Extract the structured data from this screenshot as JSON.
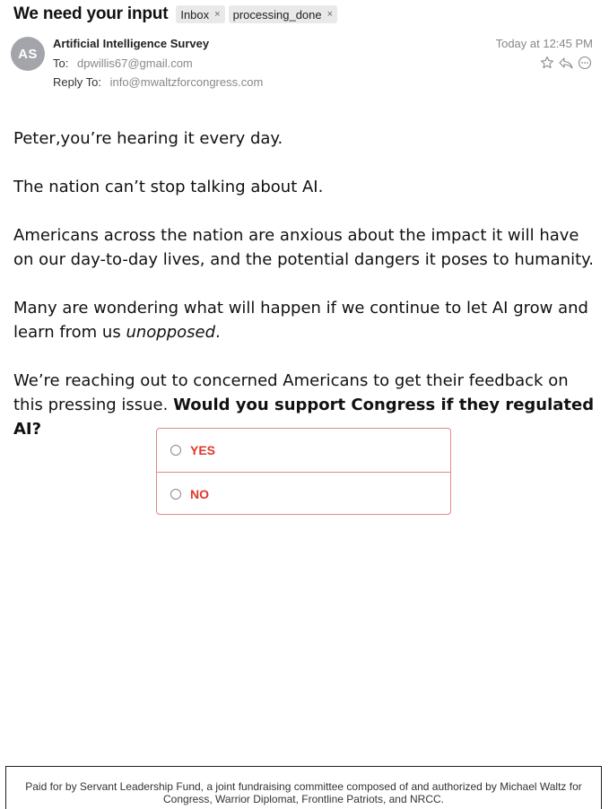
{
  "header": {
    "subject": "We need your input",
    "tags": [
      {
        "label": "Inbox",
        "remove": "×"
      },
      {
        "label": "processing_done",
        "remove": "×"
      }
    ],
    "avatar_initials": "AS",
    "sender": "Artificial Intelligence Survey",
    "to_label": "To:",
    "to_value": "dpwillis67@gmail.com",
    "reply_label": "Reply To:",
    "reply_value": "info@mwaltzforcongress.com",
    "timestamp": "Today at 12:45 PM",
    "action_icons": [
      "star-icon",
      "reply-icon",
      "more-icon"
    ]
  },
  "body": {
    "p1": "Peter,you’re hearing it every day.",
    "p2": "The nation can’t stop talking about AI.",
    "p3": "Americans across the nation are anxious about the impact it will have on our day-to-day lives, and the potential dangers it poses to humanity.",
    "p4_start": "Many are wondering what will happen if we continue to let AI grow and learn from us ",
    "p4_em": "unopposed",
    "p4_end": ".",
    "p5_start": "We’re reaching out to concerned Americans to get their feedback on this pressing issue. ",
    "p5_bold": "Would you support Congress if they regulated AI?"
  },
  "poll": {
    "options": [
      "YES",
      "NO"
    ],
    "accent_color": "#e0362a",
    "border_color": "#e08a86"
  },
  "footer": {
    "text": "Paid for by Servant Leadership Fund, a joint fundraising committee composed of and authorized by Michael Waltz for Congress, Warrior Diplomat, Frontline Patriots, and NRCC."
  }
}
